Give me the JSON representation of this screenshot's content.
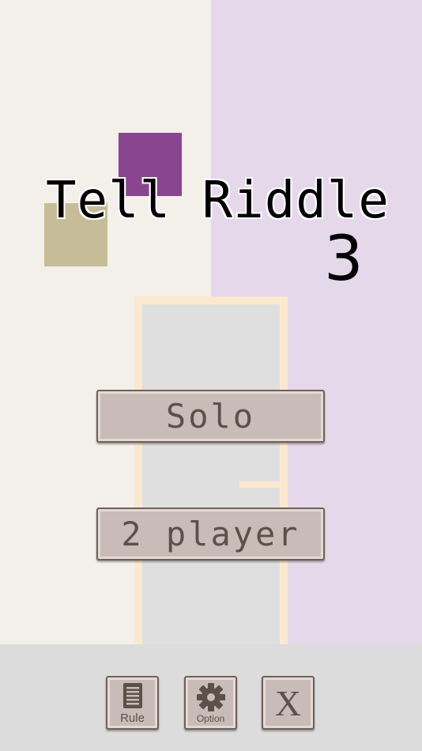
{
  "title": {
    "text": "Tell Riddle",
    "number": "3"
  },
  "menu": {
    "solo_label": "Solo",
    "two_player_label": "2 player"
  },
  "toolbar": {
    "rule": {
      "label": "Rule",
      "icon": "document-icon"
    },
    "option": {
      "label": "Option",
      "icon": "gear-icon"
    },
    "close": {
      "label": "X",
      "icon": "close-icon"
    }
  },
  "colors": {
    "wall_left": "#f3f0ea",
    "wall_right": "#e4d8ea",
    "floor": "#dcdcdc",
    "door_frame": "#fbe9cf",
    "door_panel": "#dfdfdf",
    "square_purple": "#8a4590",
    "square_tan": "#c6bd98",
    "button_fill": "#c9bbb8",
    "button_border": "#6e6258",
    "button_text": "#5c5148"
  }
}
